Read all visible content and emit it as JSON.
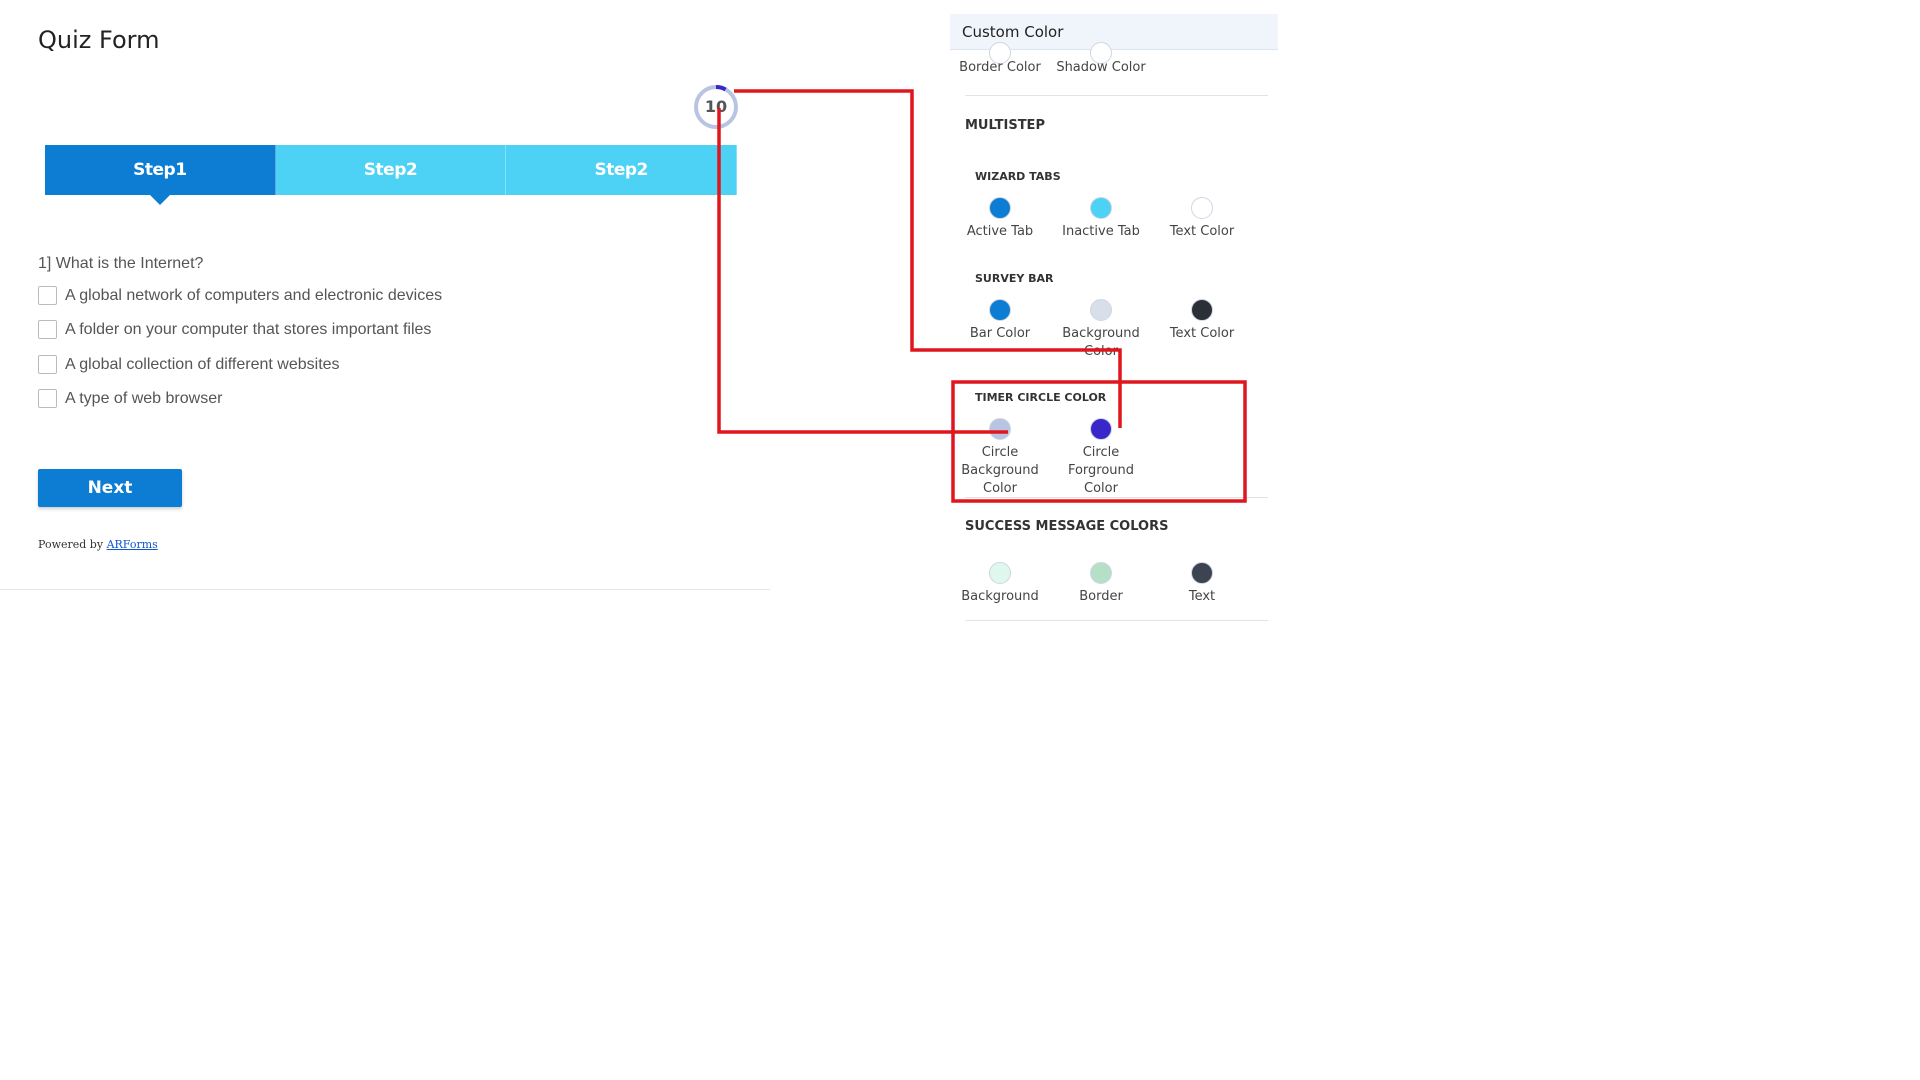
{
  "form": {
    "title": "Quiz Form",
    "timer_value": "10",
    "timer_progress": 0.08,
    "tabs": [
      {
        "label": "Step1",
        "state": "active"
      },
      {
        "label": "Step2",
        "state": "inactive"
      },
      {
        "label": "Step2",
        "state": "inactive"
      }
    ],
    "question": "1] What is the Internet?",
    "options": [
      "A global network of computers and electronic devices",
      "A folder on your computer that stores important files",
      "A global collection of different websites",
      "A type of web browser"
    ],
    "next_label": "Next",
    "powered_prefix": "Powered by ",
    "powered_link": "ARForms"
  },
  "panel": {
    "header": "Custom Color",
    "top_swatches": [
      "Border Color",
      "Shadow Color"
    ],
    "multistep_title": "MULTISTEP",
    "wizard_tabs": {
      "title": "WIZARD TABS",
      "items": [
        {
          "label": "Active Tab",
          "color": "#0c7dd3"
        },
        {
          "label": "Inactive Tab",
          "color": "#4dd1f5"
        },
        {
          "label": "Text Color",
          "color": "#ffffff"
        }
      ]
    },
    "survey_bar": {
      "title": "SURVEY BAR",
      "items": [
        {
          "label": "Bar Color",
          "color": "#0c7dd3"
        },
        {
          "label": "Background Color",
          "color": "#d9dfea"
        },
        {
          "label": "Text Color",
          "color": "#2b2f36"
        }
      ]
    },
    "timer_circle": {
      "title": "TIMER CIRCLE COLOR",
      "items": [
        {
          "label": "Circle Background Color",
          "color": "#b9c4e2"
        },
        {
          "label": "Circle Forground Color",
          "color": "#3a27c9"
        }
      ]
    },
    "success": {
      "title": "SUCCESS MESSAGE COLORS",
      "items": [
        {
          "label": "Background",
          "color": "#dff7ec"
        },
        {
          "label": "Border",
          "color": "#b6dfc8"
        },
        {
          "label": "Text",
          "color": "#3b4450"
        }
      ]
    }
  },
  "annotation_color": "#e0161e"
}
